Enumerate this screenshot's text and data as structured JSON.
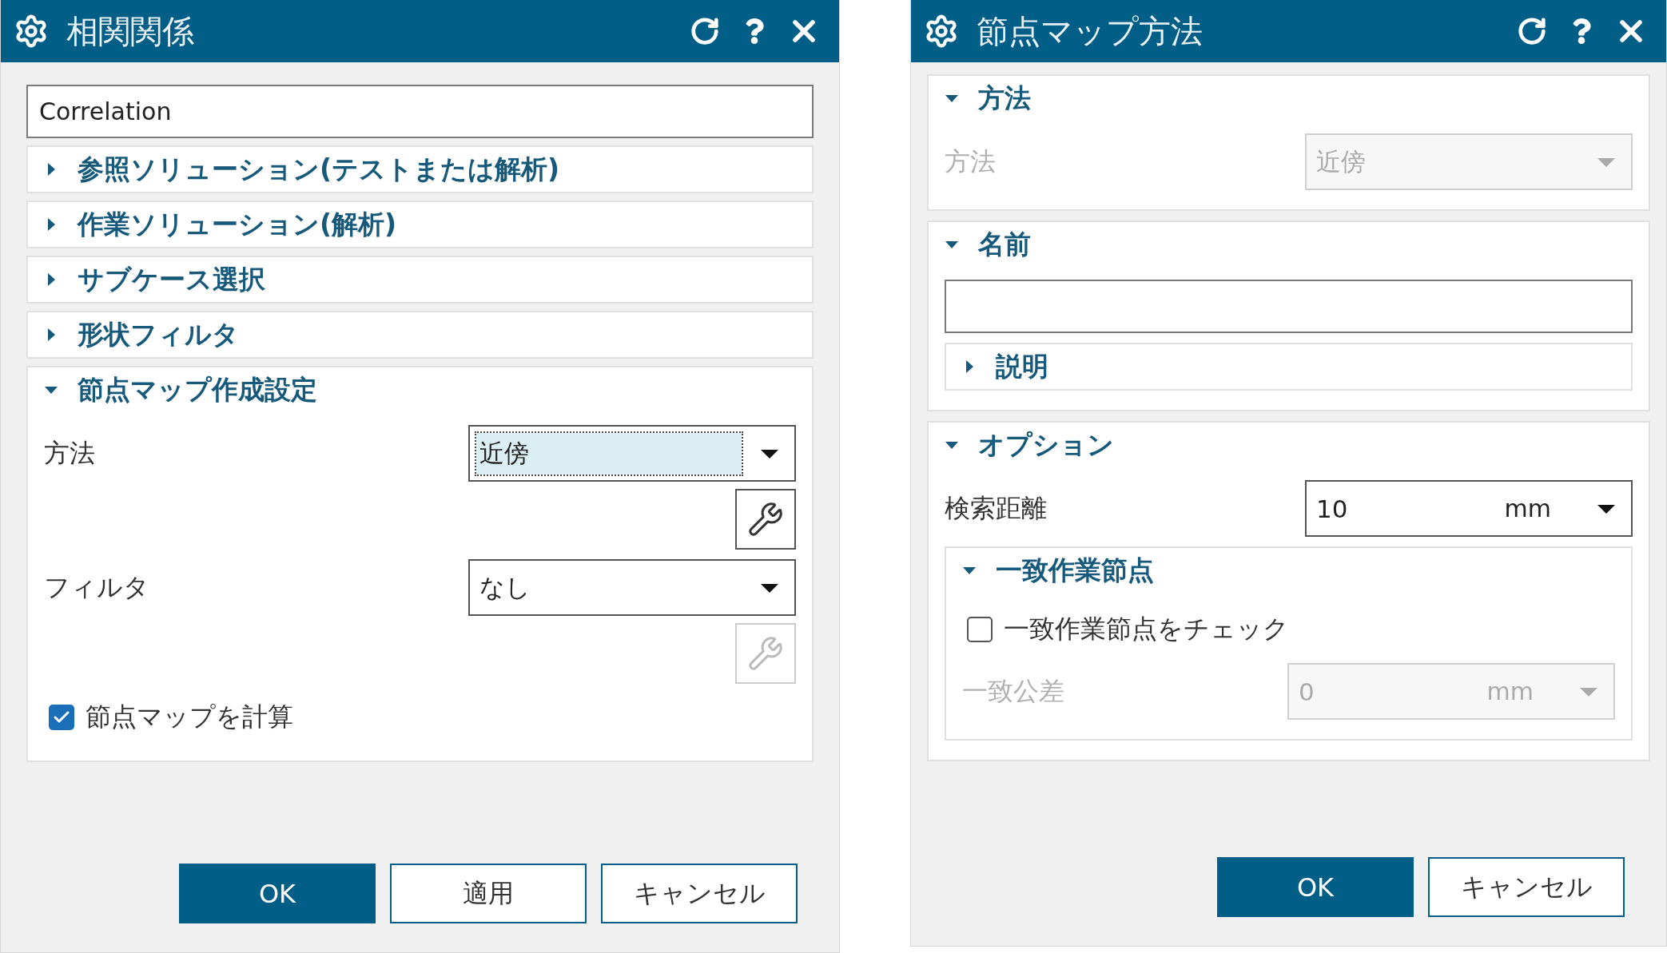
{
  "dialogs": [
    {
      "title": "相関関係",
      "items": [
        {
          "kind": "text_field",
          "value": "Correlation"
        },
        {
          "kind": "section",
          "title": "参照ソリューション(テストまたは解析)",
          "expanded": false
        },
        {
          "kind": "section",
          "title": "作業ソリューション(解析)",
          "expanded": false
        },
        {
          "kind": "section",
          "title": "サブケース選択",
          "expanded": false
        },
        {
          "kind": "section",
          "title": "形状フィルタ",
          "expanded": false
        },
        {
          "kind": "section",
          "title": "節点マップ作成設定",
          "expanded": true,
          "rows": [
            {
              "kind": "combo",
              "label": "方法",
              "value": "近傍",
              "focused": true,
              "tool_enabled": true
            },
            {
              "kind": "combo",
              "label": "フィルタ",
              "value": "なし",
              "focused": false,
              "tool_enabled": false
            },
            {
              "kind": "checkbox",
              "label": "節点マップを計算",
              "checked": true
            }
          ]
        }
      ],
      "buttons": [
        {
          "label": "OK",
          "primary": true
        },
        {
          "label": "適用",
          "primary": false
        },
        {
          "label": "キャンセル",
          "primary": false
        }
      ]
    },
    {
      "title": "節点マップ方法",
      "items": [
        {
          "kind": "section",
          "title": "方法",
          "expanded": true,
          "rows": [
            {
              "kind": "combo",
              "label": "方法",
              "value": "近傍",
              "disabled": true
            }
          ]
        },
        {
          "kind": "section",
          "title": "名前",
          "expanded": true,
          "rows": [
            {
              "kind": "text_field"
            },
            {
              "kind": "section",
              "title": "説明",
              "expanded": false
            }
          ]
        },
        {
          "kind": "section",
          "title": "オプション",
          "expanded": true,
          "rows": [
            {
              "kind": "unit_combo",
              "label": "検索距離",
              "value": "10",
              "unit": "mm",
              "disabled": false
            },
            {
              "kind": "section",
              "title": "一致作業節点",
              "expanded": true,
              "rows": [
                {
                  "kind": "checkbox",
                  "label": "一致作業節点をチェック",
                  "checked": false
                },
                {
                  "kind": "unit_combo",
                  "label": "一致公差",
                  "value": "0",
                  "unit": "mm",
                  "disabled": true
                }
              ]
            }
          ]
        }
      ],
      "buttons": [
        {
          "label": "OK",
          "primary": true
        },
        {
          "label": "キャンセル",
          "primary": false
        }
      ]
    }
  ]
}
